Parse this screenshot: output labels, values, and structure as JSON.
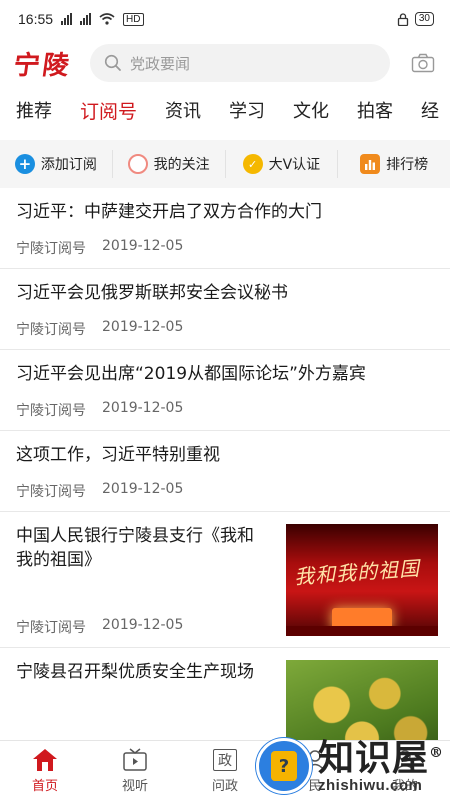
{
  "status": {
    "time": "16:55",
    "network": "HD",
    "battery": "30"
  },
  "header": {
    "logo": "宁陵",
    "search_placeholder": "党政要闻"
  },
  "tabs": [
    {
      "label": "推荐",
      "active": false
    },
    {
      "label": "订阅号",
      "active": true
    },
    {
      "label": "资讯",
      "active": false
    },
    {
      "label": "学习",
      "active": false
    },
    {
      "label": "文化",
      "active": false
    },
    {
      "label": "拍客",
      "active": false
    },
    {
      "label": "经",
      "active": false
    }
  ],
  "actions": [
    {
      "label": "添加订阅",
      "icon": "plus-icon",
      "color": "#1a8fe0"
    },
    {
      "label": "我的关注",
      "icon": "circle-icon",
      "color": "#f08a80"
    },
    {
      "label": "大V认证",
      "icon": "v-check-icon",
      "color": "#f5b800"
    },
    {
      "label": "排行榜",
      "icon": "bar-chart-icon",
      "color": "#f08a1c"
    }
  ],
  "feed": [
    {
      "title": "习近平：中萨建交开启了双方合作的大门",
      "source": "宁陵订阅号",
      "date": "2019-12-05"
    },
    {
      "title": "习近平会见俄罗斯联邦安全会议秘书",
      "source": "宁陵订阅号",
      "date": "2019-12-05"
    },
    {
      "title": "习近平会见出席“2019从都国际论坛”外方嘉宾",
      "source": "宁陵订阅号",
      "date": "2019-12-05"
    },
    {
      "title": "这项工作，习近平特别重视",
      "source": "宁陵订阅号",
      "date": "2019-12-05"
    },
    {
      "title": "中国人民银行宁陵县支行《我和我的祖国》",
      "source": "宁陵订阅号",
      "date": "2019-12-05",
      "thumb_text": "我和我的祖国"
    },
    {
      "title": "宁陵县召开梨优质安全生产现场",
      "source": "",
      "date": ""
    }
  ],
  "bottom_nav": [
    {
      "label": "首页",
      "icon": "home-icon",
      "active": true
    },
    {
      "label": "视听",
      "icon": "tv-icon",
      "active": false
    },
    {
      "label": "问政",
      "icon": "zheng-icon",
      "glyph": "政",
      "active": false
    },
    {
      "label": "民",
      "icon": "people-icon",
      "active": false
    },
    {
      "label": "我的",
      "icon": "user-icon",
      "active": false
    }
  ],
  "watermark": {
    "cn": "知识屋",
    "en": "zhishiwu.com",
    "mark": "®"
  },
  "colors": {
    "brand": "#d0191e",
    "divider": "#e8e8e8"
  }
}
